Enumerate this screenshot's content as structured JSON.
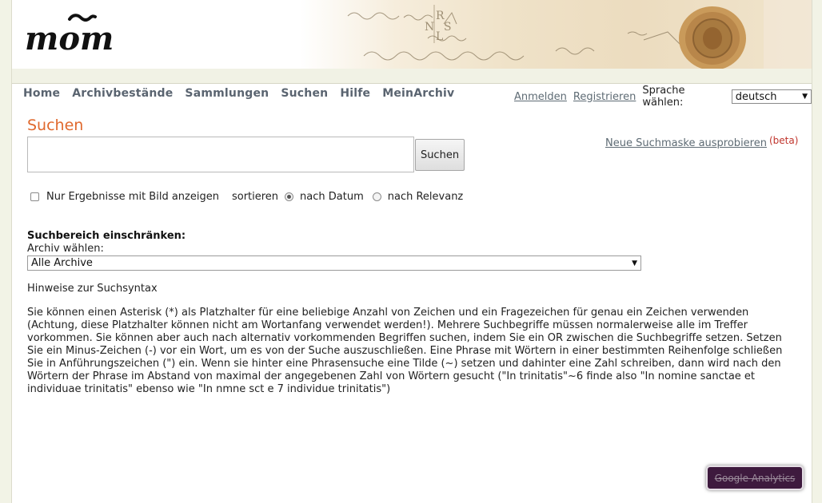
{
  "brand": {
    "logo_text": "mom"
  },
  "nav": {
    "items": [
      {
        "label": "Home"
      },
      {
        "label": "Archivbestände"
      },
      {
        "label": "Sammlungen"
      },
      {
        "label": "Suchen"
      },
      {
        "label": "Hilfe"
      },
      {
        "label": "MeinArchiv"
      }
    ]
  },
  "account": {
    "login": "Anmelden",
    "register": "Registrieren",
    "language_label": "Sprache wählen:",
    "language_selected": "deutsch"
  },
  "search": {
    "title": "Suchen",
    "query_value": "",
    "button_label": "Suchen",
    "new_mask_link": "Neue Suchmaske ausprobieren",
    "beta_tag": "(beta)"
  },
  "options": {
    "only_images_label": "Nur Ergebnisse mit Bild anzeigen",
    "only_images_checked": false,
    "sort_label": "sortieren",
    "sort_by_date": "nach Datum",
    "sort_by_relevance": "nach Relevanz",
    "sort_selected": "nach Datum"
  },
  "scope": {
    "heading": "Suchbereich einschränken:",
    "archive_label": "Archiv wählen:",
    "archive_selected": "Alle Archive"
  },
  "hints": {
    "title": "Hinweise zur Suchsyntax",
    "text": "Sie können einen Asterisk (*) als Platzhalter für eine beliebige Anzahl von Zeichen und ein Fragezeichen für genau ein Zeichen verwenden (Achtung, diese Platzhalter können nicht am Wortanfang verwendet werden!). Mehrere Suchbegriffe müssen normalerweise alle im Treffer vorkommen. Sie können aber auch nach alternativ vorkommenden Begriffen suchen, indem Sie ein OR zwischen die Suchbegriffe setzen. Setzen Sie ein Minus-Zeichen (-) vor ein Wort, um es von der Suche auszuschließen. Eine Phrase mit Wörtern in einer bestimmten Reihenfolge schließen Sie in Anführungszeichen (\") ein. Wenn sie hinter eine Phrasensuche eine Tilde (~) setzen und dahinter eine Zahl schreiben, dann wird nach den Wörtern der Phrase im Abstand von maximal der angegebenen Zahl von Wörtern gesucht (\"In trinitatis\"~6 finde also \"In nomine sanctae et individuae trinitatis\" ebenso wie \"In nmne sct e 7 individue trinitatis\")"
  },
  "analytics": {
    "badge_label": "Google Analytics"
  },
  "colors": {
    "accent": "#e0692e",
    "nav_text": "#5a6470",
    "beta": "#c0342c",
    "badge_bg": "#3e1a3e",
    "page_bg": "#f2f3e6"
  },
  "icons": {
    "dropdown": "chevron-down-icon",
    "seal": "wax-seal-icon"
  }
}
